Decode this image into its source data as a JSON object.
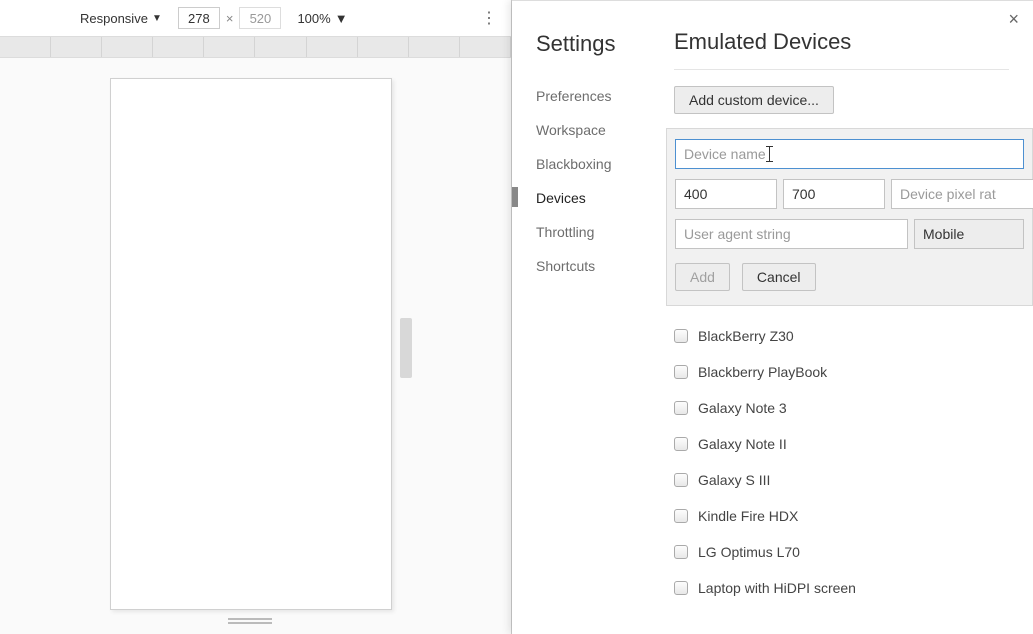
{
  "toolbar": {
    "mode": "Responsive",
    "width": "278",
    "height": "520",
    "height_color": "#999",
    "zoom": "100%",
    "more_icon": "⋮"
  },
  "settings": {
    "title": "Settings",
    "nav": [
      {
        "label": "Preferences",
        "active": false
      },
      {
        "label": "Workspace",
        "active": false
      },
      {
        "label": "Blackboxing",
        "active": false
      },
      {
        "label": "Devices",
        "active": true
      },
      {
        "label": "Throttling",
        "active": false
      },
      {
        "label": "Shortcuts",
        "active": false
      }
    ],
    "content_title": "Emulated Devices",
    "add_custom_label": "Add custom device...",
    "close_label": "×",
    "form": {
      "name_placeholder": "Device name",
      "name_value": "",
      "width_value": "400",
      "height_value": "700",
      "pxratio_placeholder": "Device pixel rat",
      "ua_placeholder": "User agent string",
      "type_label": "Mobile",
      "add_label": "Add",
      "cancel_label": "Cancel"
    },
    "devices": [
      "BlackBerry Z30",
      "Blackberry PlayBook",
      "Galaxy Note 3",
      "Galaxy Note II",
      "Galaxy S III",
      "Kindle Fire HDX",
      "LG Optimus L70",
      "Laptop with HiDPI screen"
    ]
  }
}
